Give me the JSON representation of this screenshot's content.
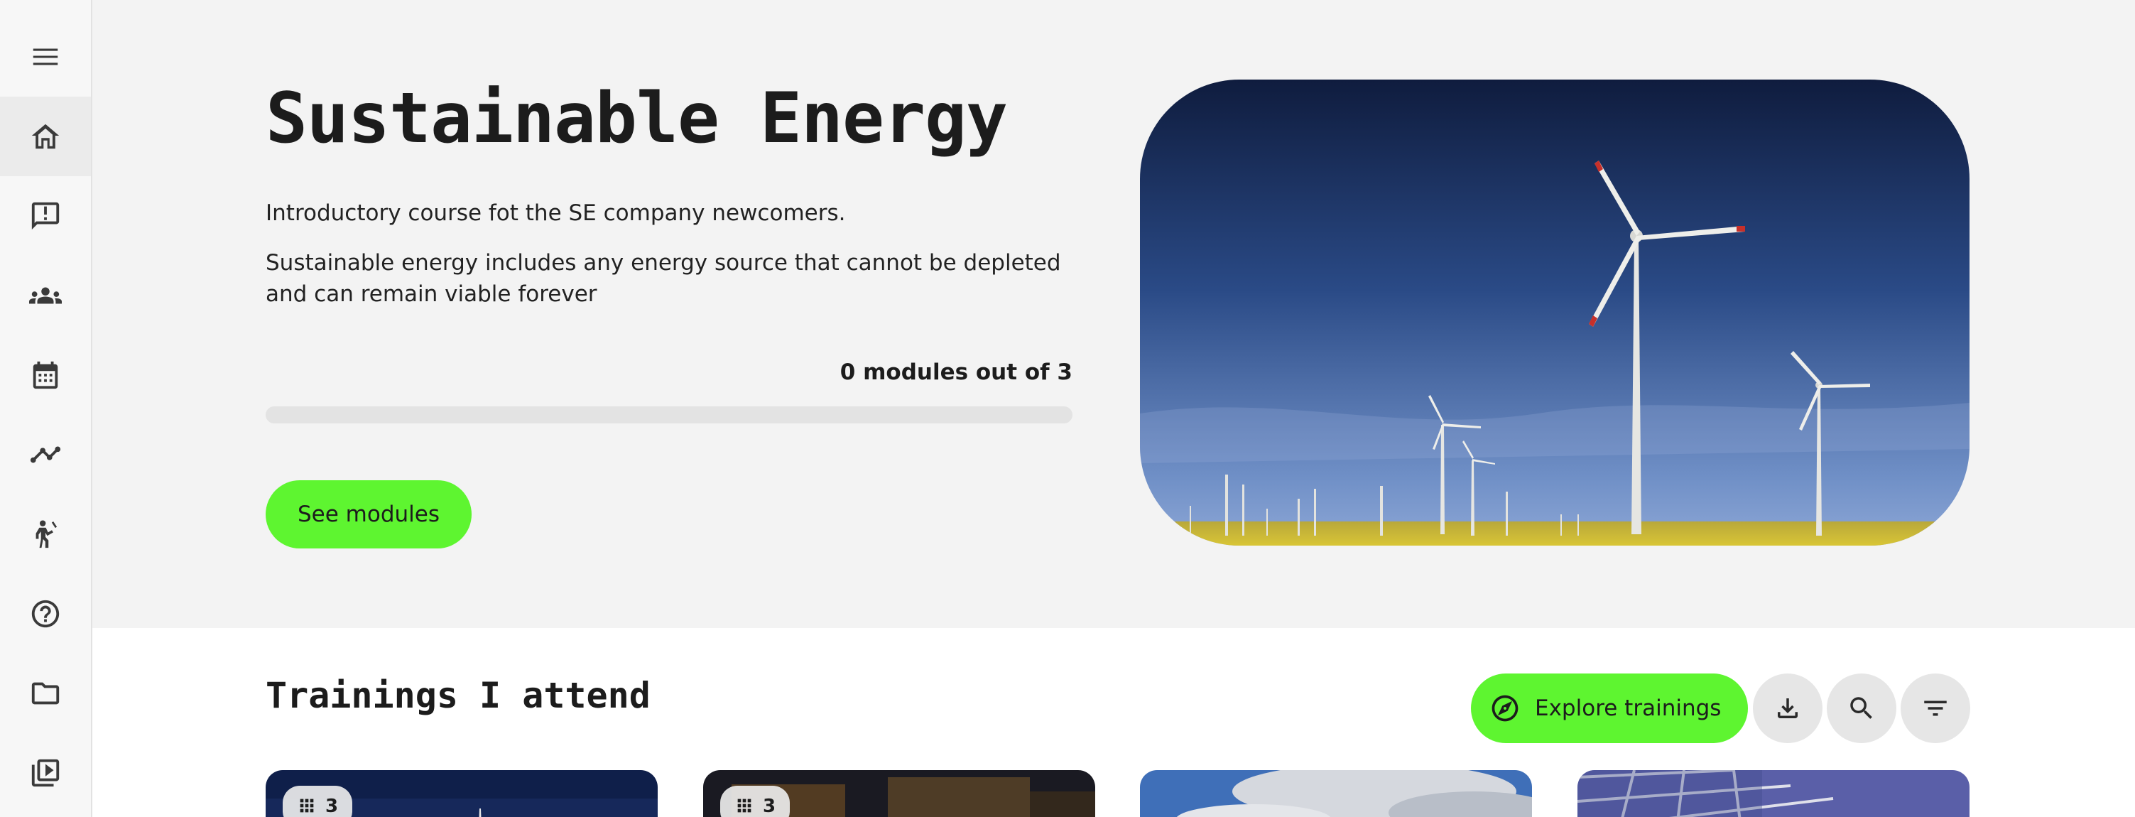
{
  "sidebar": {
    "items": [
      {
        "icon": "menu-icon"
      },
      {
        "icon": "home-icon",
        "active": true
      },
      {
        "icon": "feedback-icon"
      },
      {
        "icon": "groups-icon"
      },
      {
        "icon": "calendar-icon"
      },
      {
        "icon": "analytics-icon"
      },
      {
        "icon": "activity-icon"
      },
      {
        "icon": "help-icon"
      },
      {
        "icon": "folder-icon"
      },
      {
        "icon": "video-library-icon"
      }
    ]
  },
  "hero": {
    "title": "Sustainable Energy",
    "subtitle": "Introductory course fot the SE company newcomers.",
    "description": "Sustainable energy includes any energy source that cannot be depleted and can remain viable forever",
    "progress_text": "0 modules out of 3",
    "progress_fraction": 0,
    "cta_label": "See modules",
    "image": "wind-turbines-photo"
  },
  "trainings": {
    "title": "Trainings I attend",
    "explore_label": "Explore trainings",
    "actions": [
      "download-icon",
      "search-icon",
      "filter-icon"
    ],
    "cards": [
      {
        "module_count": "3",
        "image": "wind-turbine-night"
      },
      {
        "module_count": "3",
        "image": "city-lights-night"
      },
      {
        "image": "cloudy-sky"
      },
      {
        "image": "solar-panels"
      }
    ]
  },
  "colors": {
    "accent": "#5ef530",
    "background": "#f3f3f3",
    "section_background": "#ffffff",
    "text": "#1c1c1c"
  }
}
